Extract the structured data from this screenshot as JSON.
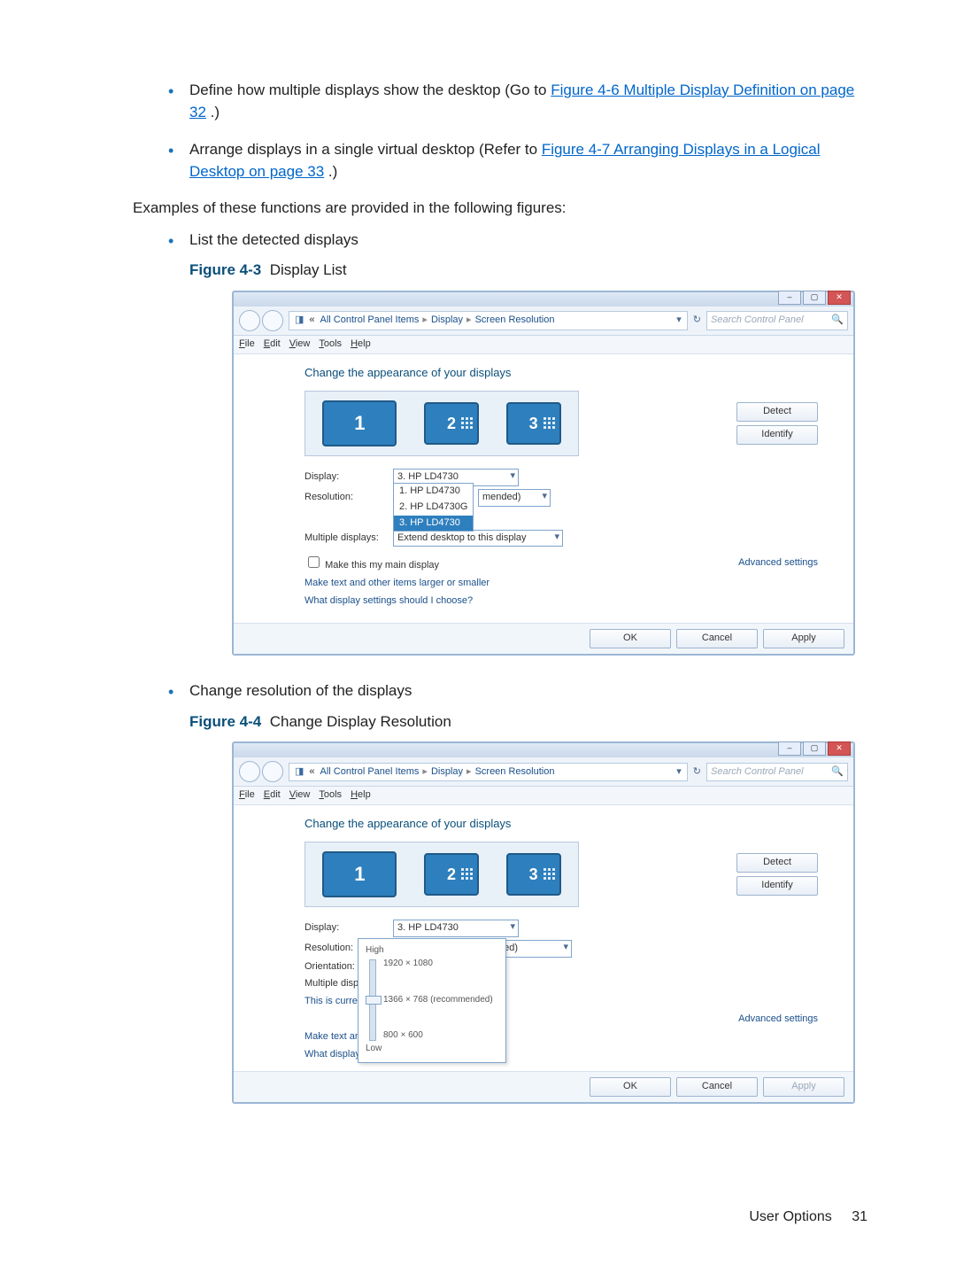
{
  "bullets_top": [
    {
      "pre": "Define how multiple displays show the desktop (Go to ",
      "link": "Figure 4-6 Multiple Display Definition on page 32",
      "post": ".)"
    },
    {
      "pre": "Arrange displays in a single virtual desktop (Refer to ",
      "link": "Figure 4-7 Arranging Displays in a Logical Desktop on page 33",
      "post": ".)"
    }
  ],
  "intro": "Examples of these functions are provided in the following figures:",
  "fig1": {
    "bullet": "List the detected displays",
    "label": "Figure 4-3",
    "title": "Display List"
  },
  "fig2": {
    "bullet": "Change resolution of the displays",
    "label": "Figure 4-4",
    "title": "Change Display Resolution"
  },
  "win": {
    "breadcrumb": [
      "All Control Panel Items",
      "Display",
      "Screen Resolution"
    ],
    "search_placeholder": "Search Control Panel",
    "menus": [
      "File",
      "Edit",
      "View",
      "Tools",
      "Help"
    ],
    "heading": "Change the appearance of your displays",
    "detect": "Detect",
    "identify": "Identify",
    "labels": {
      "display": "Display:",
      "resolution": "Resolution:",
      "orientation": "Orientation:",
      "multiple": "Multiple displays:"
    },
    "display_value": "3. HP LD4730",
    "display_options": [
      "1. HP LD4730",
      "2. HP LD4730G",
      "3. HP LD4730"
    ],
    "resolution_value": "1366 × 768 (recommended)",
    "resolution_tail": "mended)",
    "multidsp_value": "Extend desktop to this display",
    "main_checkbox": "Make this my main display",
    "this_is_main": "This is currently your",
    "adv": "Advanced settings",
    "link1": "Make text and other items larger or smaller",
    "link1_short": "Make text and other",
    "link2": "What display settings should I choose?",
    "link2_short": "What display settings",
    "ok": "OK",
    "cancel": "Cancel",
    "apply": "Apply",
    "res_slider": {
      "high": "High",
      "top": "1920 × 1080",
      "mid": "1366 × 768 (recommended)",
      "bot": "800 × 600",
      "low": "Low"
    }
  },
  "footer": {
    "section": "User Options",
    "page": "31"
  }
}
